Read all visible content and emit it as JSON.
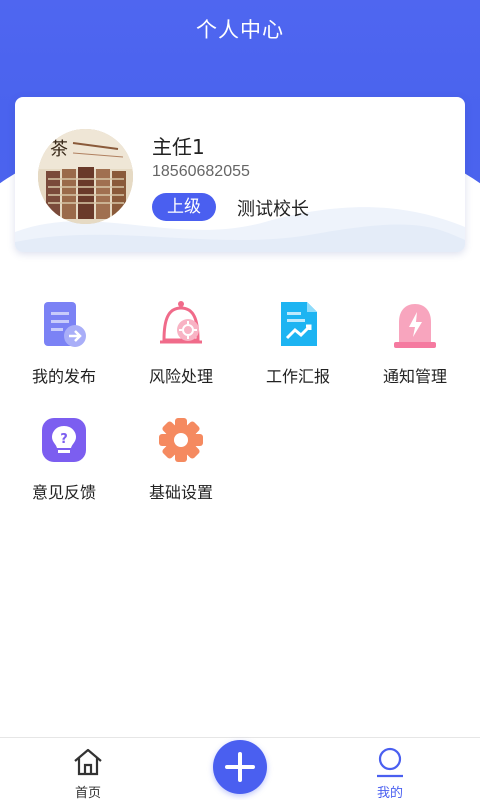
{
  "header": {
    "title": "个人中心"
  },
  "profile": {
    "name": "主任1",
    "phone": "18560682055",
    "role_badge": "上级",
    "role_title": "测试校长"
  },
  "menu": [
    {
      "label": "我的发布",
      "icon": "publish-doc-icon",
      "color": "#6b73f5"
    },
    {
      "label": "风险处理",
      "icon": "risk-bell-icon",
      "color": "#f06b8a"
    },
    {
      "label": "工作汇报",
      "icon": "report-chart-icon",
      "color": "#1db4f2"
    },
    {
      "label": "通知管理",
      "icon": "alarm-light-icon",
      "color": "#f57aa0"
    },
    {
      "label": "意见反馈",
      "icon": "feedback-bulb-icon",
      "color": "#7c5ef0"
    },
    {
      "label": "基础设置",
      "icon": "settings-gear-icon",
      "color": "#f58a60"
    }
  ],
  "tabbar": {
    "home_label": "首页",
    "mine_label": "我的",
    "accent": "#4a5ff0"
  }
}
